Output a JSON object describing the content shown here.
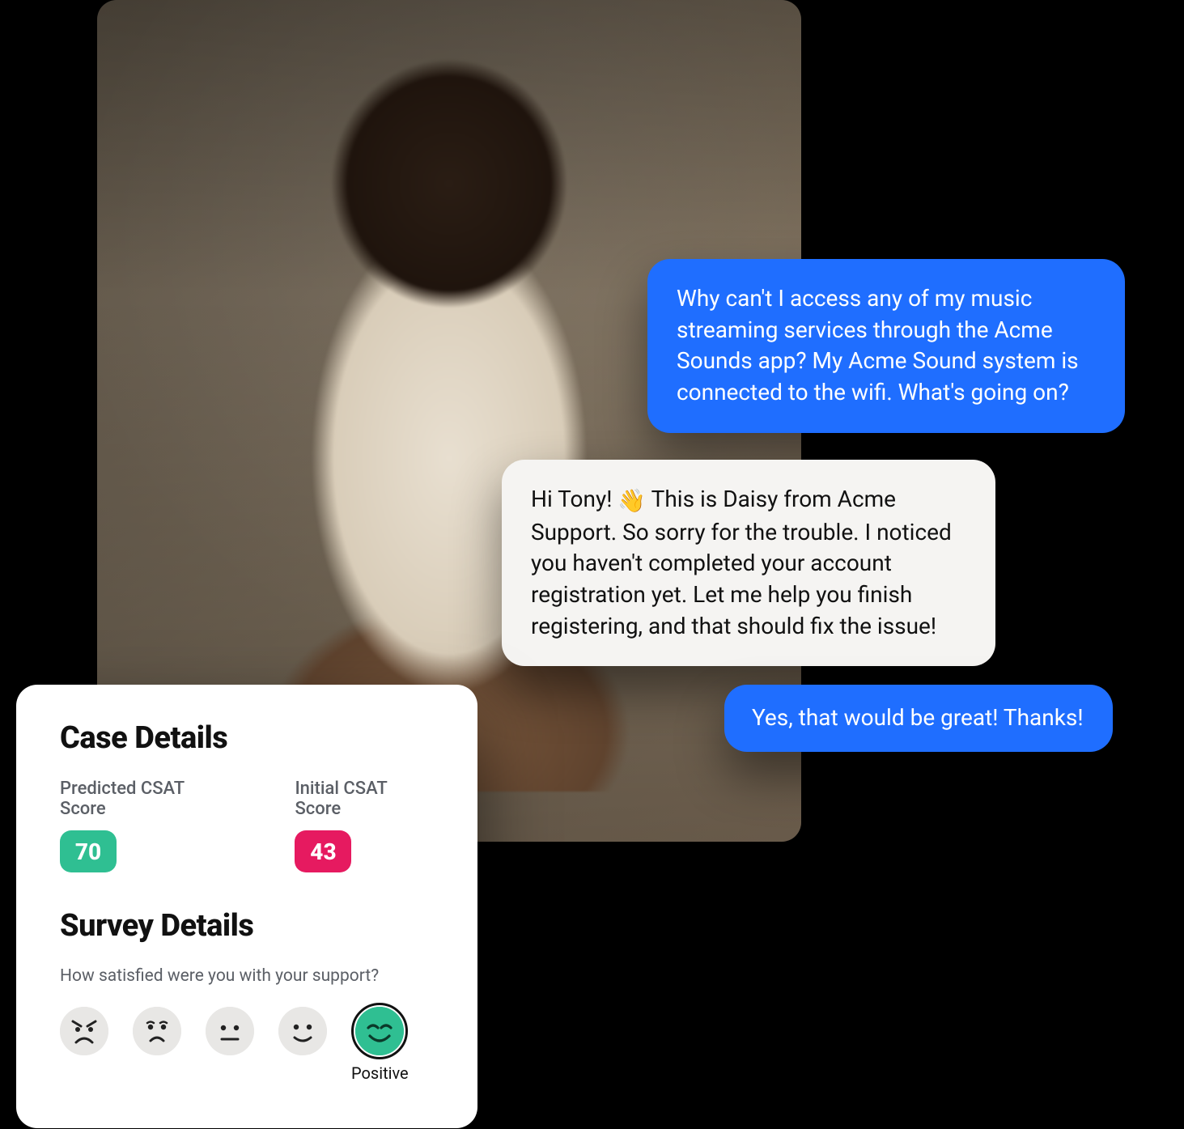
{
  "chat": {
    "msg1": "Why can't I access any of my music streaming services through the Acme Sounds app? My Acme Sound system is connected to the wifi.  What's going on?",
    "msg2_prefix": "Hi Tony! ",
    "msg2_emoji": "👋",
    "msg2_rest": " This is Daisy from Acme Support. So sorry for the trouble. I noticed you haven't completed your account registration yet. Let me help you finish registering, and that should fix the issue!",
    "msg3": "Yes, that would be great! Thanks!"
  },
  "case": {
    "heading": "Case Details",
    "predicted_label": "Predicted CSAT Score",
    "predicted_value": "70",
    "initial_label": "Initial CSAT Score",
    "initial_value": "43"
  },
  "survey": {
    "heading": "Survey Details",
    "question": "How satisfied were you with your support?",
    "selected_label": "Positive",
    "options": [
      "angry",
      "sad",
      "neutral",
      "happy",
      "positive"
    ]
  },
  "colors": {
    "blue": "#1f6eff",
    "green": "#2fbf92",
    "pink": "#e61a60"
  }
}
